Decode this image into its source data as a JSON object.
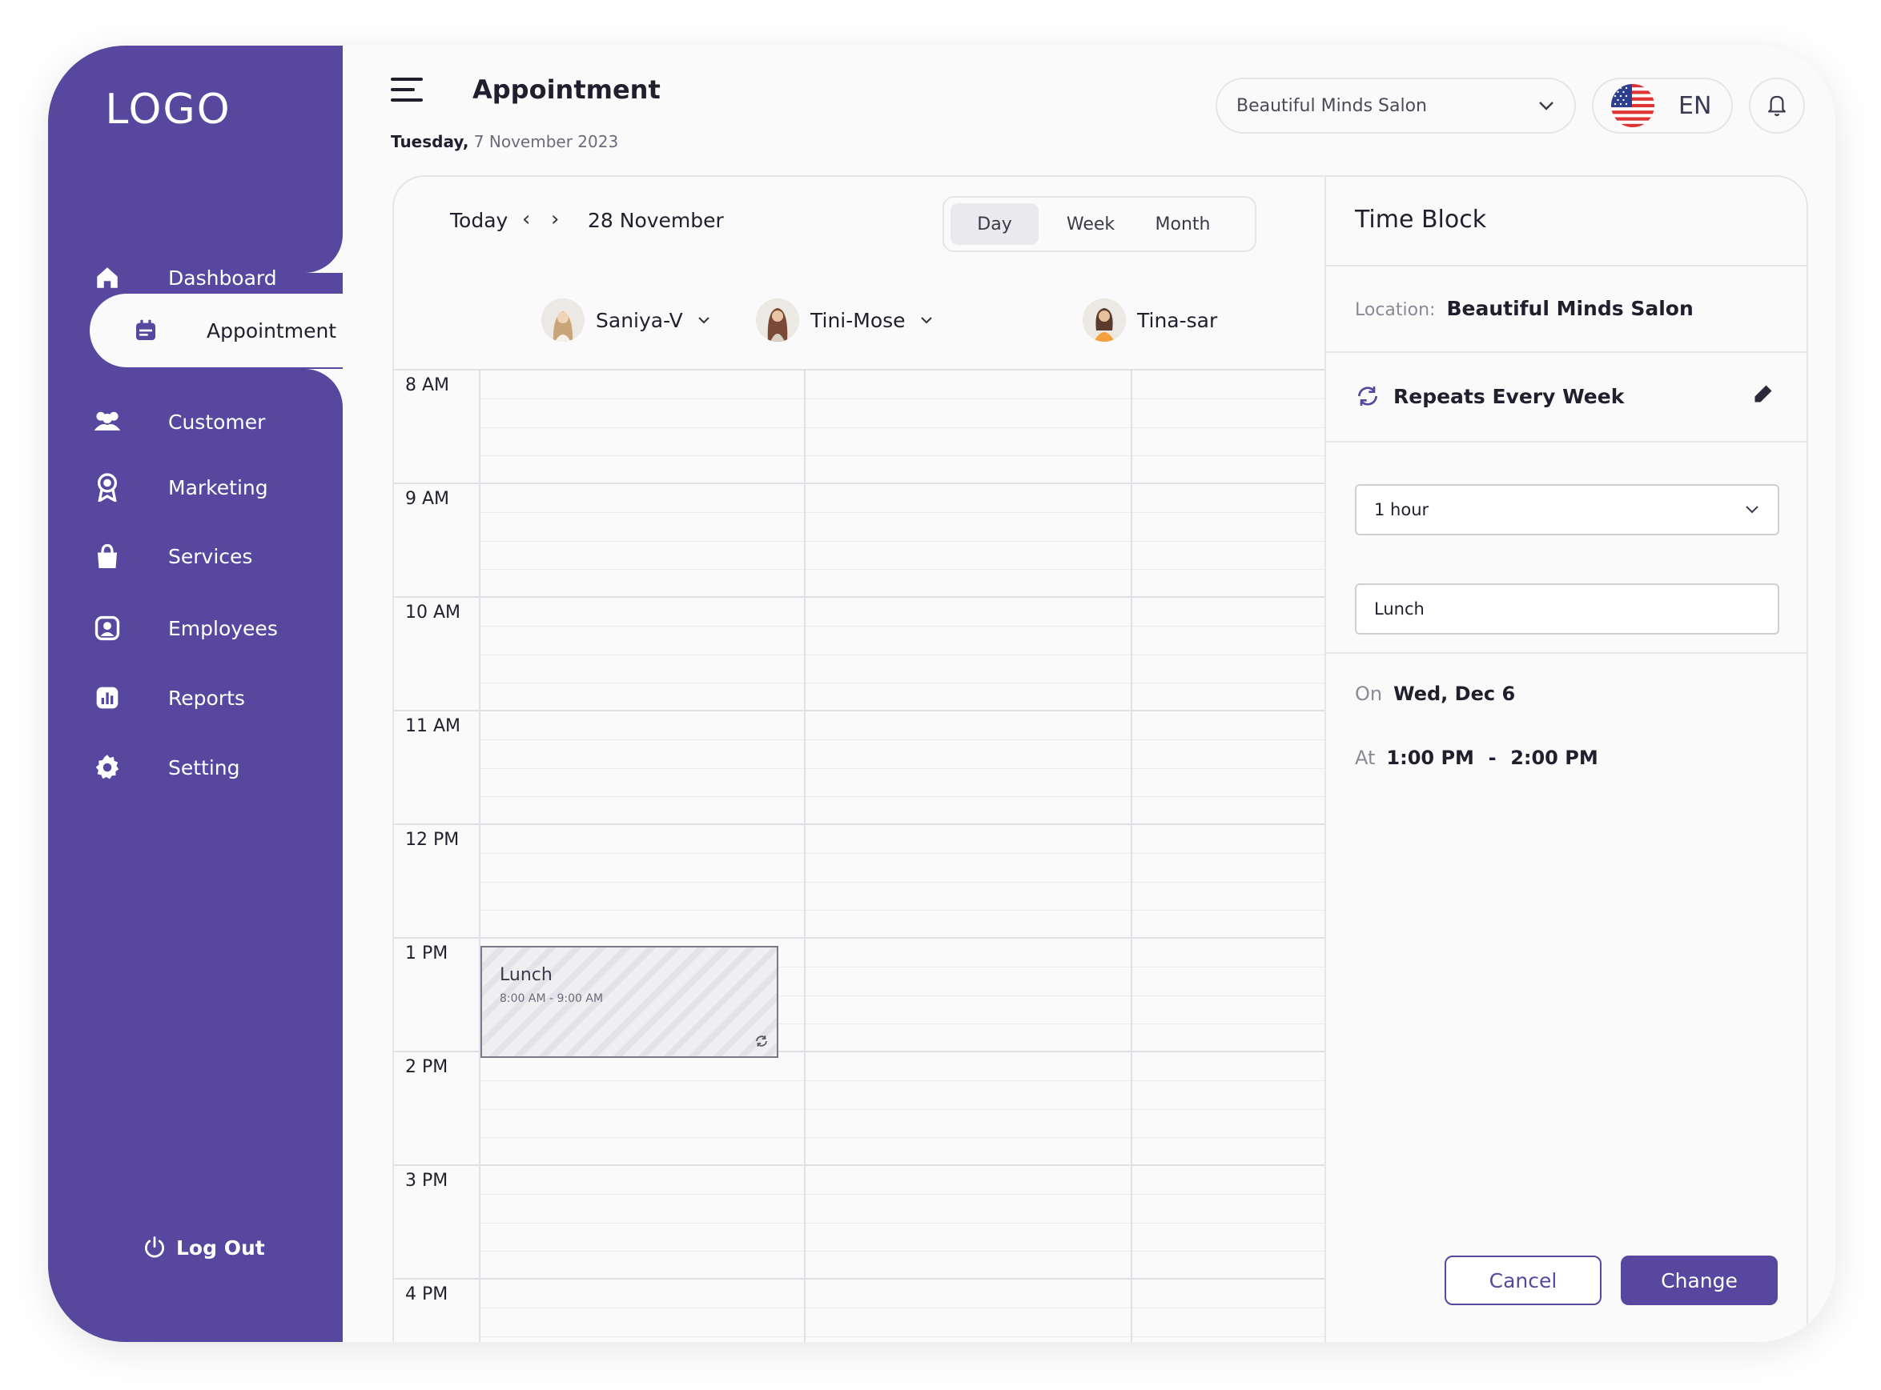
{
  "app": {
    "logo": "LOGO"
  },
  "sidebar": {
    "items": [
      {
        "label": "Dashboard",
        "icon": "home-icon"
      },
      {
        "label": "Appointment",
        "icon": "calendar-icon"
      },
      {
        "label": "Customer",
        "icon": "users-icon"
      },
      {
        "label": "Marketing",
        "icon": "badge-icon"
      },
      {
        "label": "Services",
        "icon": "bag-icon"
      },
      {
        "label": "Employees",
        "icon": "employee-icon"
      },
      {
        "label": "Reports",
        "icon": "chart-icon"
      },
      {
        "label": "Setting",
        "icon": "gear-icon"
      }
    ],
    "active": "Appointment",
    "logout": "Log Out"
  },
  "header": {
    "title": "Appointment",
    "date_day": "Tuesday,",
    "date_rest": " 7 November 2023",
    "salon": "Beautiful Minds Salon",
    "language": "EN"
  },
  "calendar": {
    "today": "Today",
    "prev": "‹",
    "next": "›",
    "current": "28 November",
    "views": [
      "Day",
      "Week",
      "Month"
    ],
    "selected_view": "Day",
    "staff": [
      "Saniya-V",
      "Tini-Mose",
      "Tina-sar"
    ],
    "hours": [
      "8  AM",
      "9  AM",
      "10  AM",
      "11  AM",
      "12  PM",
      "1  PM",
      "2  PM",
      "3  PM",
      "4  PM"
    ],
    "event": {
      "title": "Lunch",
      "time": "8:00 AM - 9:00 AM"
    }
  },
  "panel": {
    "title": "Time Block",
    "location_label": "Location:",
    "location": "Beautiful Minds Salon",
    "repeat": "Repeats Every Week",
    "duration": "1 hour",
    "name": "Lunch",
    "on_label": "On",
    "on_value": "Wed, Dec 6",
    "at_label": "At",
    "at_start": "1:00 PM",
    "at_sep": "-",
    "at_end": "2:00 PM",
    "cancel": "Cancel",
    "change": "Change"
  },
  "colors": {
    "brand": "#58479e",
    "background": "#fafafa"
  }
}
